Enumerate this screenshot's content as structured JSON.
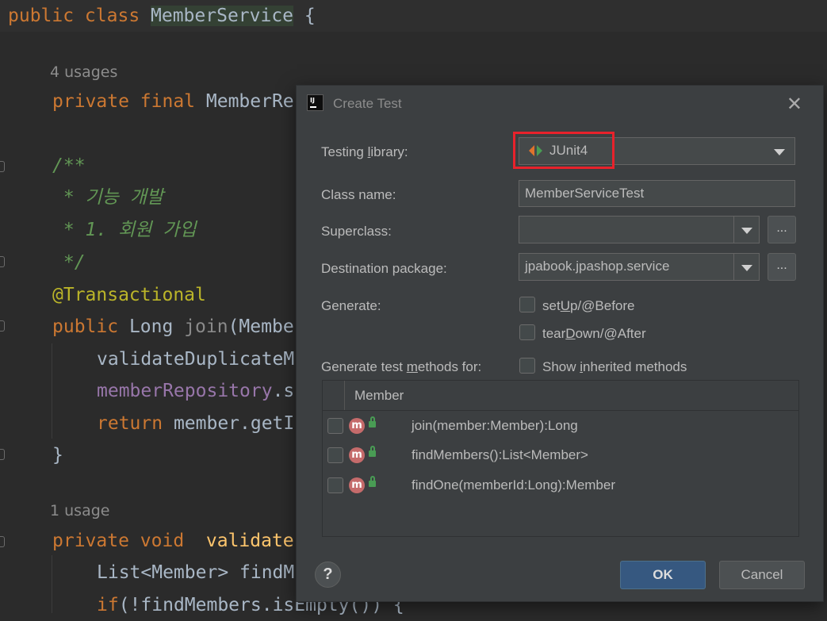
{
  "editor": {
    "lines": [
      {
        "parts": [
          {
            "t": "public class ",
            "c": "kw"
          },
          {
            "t": "MemberService",
            "c": "cls-hl"
          },
          {
            "t": " {",
            "c": ""
          }
        ]
      },
      {
        "usage": "4 usages"
      },
      {
        "parts": [
          {
            "t": "private final ",
            "c": "kw"
          },
          {
            "t": "MemberRe",
            "c": ""
          }
        ]
      },
      {
        "parts": [
          {
            "t": "/**",
            "c": "cmt"
          }
        ]
      },
      {
        "parts": [
          {
            "t": " * 기능 개발",
            "c": "cmt"
          }
        ]
      },
      {
        "parts": [
          {
            "t": " * 1. 회원 가입",
            "c": "cmt"
          }
        ]
      },
      {
        "parts": [
          {
            "t": " */",
            "c": "cmt"
          }
        ]
      },
      {
        "parts": [
          {
            "t": "@Transactional",
            "c": "ann"
          }
        ]
      },
      {
        "parts": [
          {
            "t": "public ",
            "c": "kw"
          },
          {
            "t": "Long ",
            "c": ""
          },
          {
            "t": "join",
            "c": "gray"
          },
          {
            "t": "(Membe",
            "c": ""
          }
        ]
      },
      {
        "parts": [
          {
            "t": "validateDuplicateM",
            "c": ""
          }
        ]
      },
      {
        "parts": [
          {
            "t": "memberRepository",
            "c": "fld"
          },
          {
            "t": ".s",
            "c": ""
          }
        ]
      },
      {
        "parts": [
          {
            "t": "return ",
            "c": "kw"
          },
          {
            "t": "member.getI",
            "c": ""
          }
        ]
      },
      {
        "parts": [
          {
            "t": "}",
            "c": ""
          }
        ]
      },
      {
        "usage": "1 usage"
      },
      {
        "parts": [
          {
            "t": "private void  ",
            "c": "kw"
          },
          {
            "t": "validate",
            "c": "mth"
          }
        ]
      },
      {
        "parts": [
          {
            "t": "List<Member> findM",
            "c": ""
          }
        ]
      },
      {
        "parts": [
          {
            "t": "if",
            "c": "kw"
          },
          {
            "t": "(!findMembers.isEmpty()) {",
            "c": ""
          }
        ]
      }
    ]
  },
  "dialog": {
    "title": "Create Test",
    "close_glyph": "✕",
    "testing_library": {
      "label_pre": "Testing ",
      "label_u": "l",
      "label_post": "ibrary:",
      "value": "JUnit4"
    },
    "class_name": {
      "label": "Class name:",
      "value": "MemberServiceTest"
    },
    "superclass": {
      "label": "Superclass:",
      "value": "",
      "browse": "..."
    },
    "destination": {
      "label": "Destination package:",
      "value": "jpabook.jpashop.service",
      "browse": "..."
    },
    "generate": {
      "label": "Generate:",
      "setup": {
        "pre": "set",
        "u": "U",
        "post": "p/@Before"
      },
      "teardown": {
        "pre": "tear",
        "u": "D",
        "post": "own/@After"
      }
    },
    "methods_for": {
      "pre": "Generate test ",
      "u": "m",
      "post": "ethods for:"
    },
    "show_inherited": {
      "pre": "Show ",
      "u": "i",
      "post": "nherited methods"
    },
    "table": {
      "header": "Member",
      "rows": [
        {
          "icon": "m",
          "text": "join(member:Member):Long"
        },
        {
          "icon": "m",
          "text": "findMembers():List<Member>"
        },
        {
          "icon": "m",
          "text": "findOne(memberId:Long):Member"
        }
      ]
    },
    "help": "?",
    "ok": "OK",
    "cancel": "Cancel"
  },
  "colors": {
    "highlight_box": "#e8222b",
    "ok_button": "#365880",
    "dialog_bg": "#3c3f41",
    "editor_bg": "#2b2b2b"
  }
}
